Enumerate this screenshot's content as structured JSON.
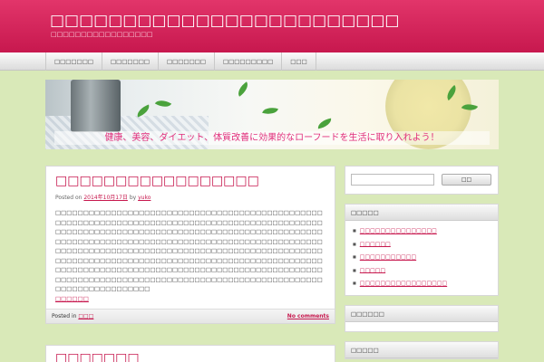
{
  "header": {
    "site_title": "□□□□□□□□□□□□□□□□□□□□□□□□",
    "site_description": "□□□□□□□□□□□□□□□□□"
  },
  "nav": {
    "items": [
      {
        "label": "□□□□□□□"
      },
      {
        "label": "□□□□□□□"
      },
      {
        "label": "□□□□□□□"
      },
      {
        "label": "□□□□□□□□□"
      },
      {
        "label": "□□□"
      }
    ]
  },
  "banner": {
    "tagline": "健康、美容、ダイエット、体質改善に効果的なローフードを生活に取り入れよう！"
  },
  "posts": [
    {
      "title": "□□□□□□□□□□□□□□□□□",
      "meta_prefix": "Posted on",
      "date": "2014年10月17日",
      "by": "by",
      "author": "yuko",
      "excerpt": "□□□□□□□□□□□□□□□□□□□□□□□□□□□□□□□□□□□□□□□□□□□□□□□□□□□□□□□□□□□□□□□□□□□□□□□□□□□□□□□□□□□□□□□□□□□□□□□□□□□□□□□□□□□□□□□□□□□□□□□□□□□□□□□□□□□□□□□□□□□□□□□□□□□□□□□□□□□□□□□□□□□□□□□□□□□□□□□□□□□□□□□□□□□□□□□□□□□□□□□□□□□□□□□□□□□□□□□□□□□□□□□□□□□□□□□□□□□□□□□□□□□□□□□□□□□□□□□□□□□□□□□□□□□□□□□□□□□□□□□□□□□□□□□□□□□□□□□□□□□□□□□□□□□□□□□□□□□□□□□□□□□□□□□□□□□□□□□□□□□□□□□□□□□□□□□□□□□□□□□□□□□□□□□□□□□□□□□□□□□□□□□□□□□□□□□□□□□□□□□□□",
      "read_more": "□□□□□□",
      "footer_prefix": "Posted in",
      "category": "□□□",
      "comments": "No comments"
    },
    {
      "title": "□□□□□□□"
    }
  ],
  "sidebar": {
    "search_placeholder": "",
    "search_button": "□□",
    "widgets": [
      {
        "title": "□□□□□",
        "items": [
          {
            "label": "□□□□□□□□□□□□□□□"
          },
          {
            "label": "□□□□□□"
          },
          {
            "label": "□□□□□□□□□□□"
          },
          {
            "label": "□□□□□"
          },
          {
            "label": "□□□□□□□□□□□□□□□□□"
          }
        ]
      },
      {
        "title": "□□□□□□"
      },
      {
        "title": "□□□□□"
      }
    ]
  },
  "colors": {
    "brand": "#c7184e",
    "page_background": "#d9e9b8",
    "banner_text": "#e12d7b"
  }
}
